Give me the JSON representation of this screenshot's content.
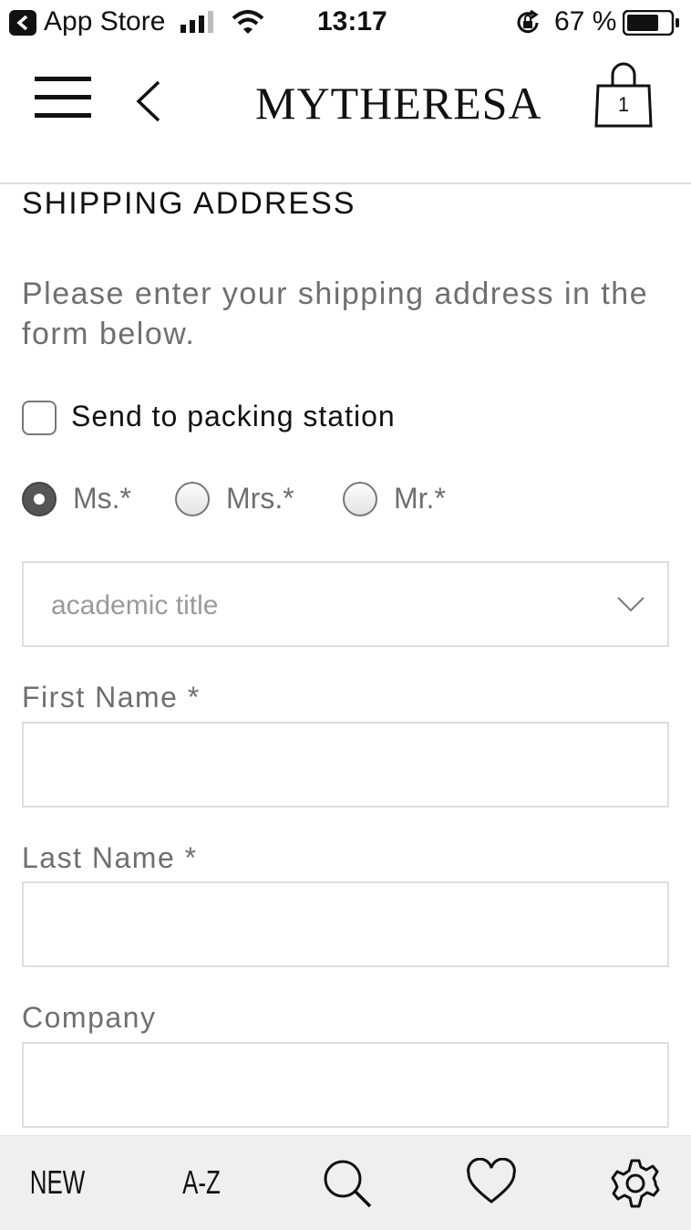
{
  "status_bar": {
    "app": "App Store",
    "time": "13:17",
    "battery": "67 %"
  },
  "header": {
    "brand": "MYTHERESA",
    "bag_count": "1"
  },
  "form": {
    "title": "SHIPPING ADDRESS",
    "intro": "Please enter your shipping address in the form below.",
    "packing_station_label": "Send to packing station",
    "packing_station_checked": false,
    "salutations": [
      {
        "label": "Ms.*",
        "checked": true
      },
      {
        "label": "Mrs.*",
        "checked": false
      },
      {
        "label": "Mr.*",
        "checked": false
      }
    ],
    "academic_title_placeholder": "academic title",
    "fields": [
      {
        "label": "First Name *",
        "value": ""
      },
      {
        "label": "Last Name *",
        "value": ""
      },
      {
        "label": "Company",
        "value": ""
      }
    ]
  },
  "tabbar": {
    "new_label": "NEW",
    "az_label": "A-Z",
    "icons": [
      "search-icon",
      "heart-icon",
      "gear-icon"
    ]
  },
  "colors": {
    "text_primary": "#111111",
    "text_secondary": "#6f6f6f",
    "placeholder": "#9a9a9a",
    "border": "#dedede",
    "tabbar_bg": "#efefef"
  }
}
